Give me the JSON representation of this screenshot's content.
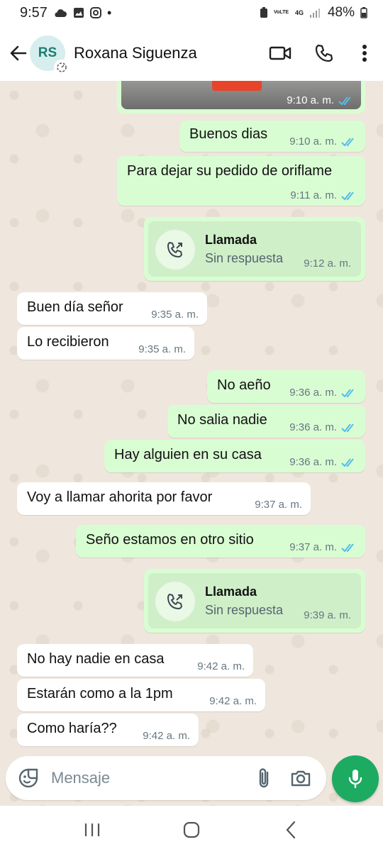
{
  "status_bar": {
    "time": "9:57",
    "dot": "•",
    "net_volte": "VoLTE",
    "net_4g": "4G",
    "battery": "48%"
  },
  "header": {
    "avatar_initials": "RS",
    "contact_name": "Roxana Siguenza"
  },
  "messages": [
    {
      "type": "image",
      "time": "9:10 a. m.",
      "dir": "out",
      "read": true
    },
    {
      "type": "text",
      "dir": "out",
      "text": "Buenos dias",
      "time": "9:10 a. m."
    },
    {
      "type": "text",
      "dir": "out",
      "text": "Para dejar su pedido de oriflame",
      "time": "9:11 a. m."
    },
    {
      "type": "call",
      "dir": "out",
      "title": "Llamada",
      "subtitle": "Sin respuesta",
      "time": "9:12 a. m."
    },
    {
      "type": "text",
      "dir": "in",
      "text": "Buen día señor",
      "time": "9:35 a. m."
    },
    {
      "type": "text",
      "dir": "in",
      "text": "Lo recibieron",
      "time": "9:35 a. m."
    },
    {
      "type": "text",
      "dir": "out",
      "text": "No aeño",
      "time": "9:36 a. m."
    },
    {
      "type": "text",
      "dir": "out",
      "text": "No salia nadie",
      "time": "9:36 a. m."
    },
    {
      "type": "text",
      "dir": "out",
      "text": "Hay alguien en su casa",
      "time": "9:36 a. m."
    },
    {
      "type": "text",
      "dir": "in",
      "text": "Voy a llamar ahorita por favor",
      "time": "9:37 a. m."
    },
    {
      "type": "text",
      "dir": "out",
      "text": "Seño estamos en otro sitio",
      "time": "9:37 a. m."
    },
    {
      "type": "call",
      "dir": "out",
      "title": "Llamada",
      "subtitle": "Sin respuesta",
      "time": "9:39 a. m."
    },
    {
      "type": "text",
      "dir": "in",
      "text": "No hay nadie en casa",
      "time": "9:42 a. m."
    },
    {
      "type": "text",
      "dir": "in",
      "text": "Estarán como a la 1pm",
      "time": "9:42 a. m."
    },
    {
      "type": "text",
      "dir": "in",
      "text": "Como haría??",
      "time": "9:42 a. m."
    }
  ],
  "input": {
    "placeholder": "Mensaje",
    "value": ""
  },
  "icons": {
    "back": "arrow-left-icon",
    "video": "video-camera-icon",
    "phone": "phone-icon",
    "menu": "more-vertical-icon",
    "emoji": "sticker-icon",
    "attach": "paperclip-icon",
    "camera": "camera-icon",
    "mic": "microphone-icon"
  },
  "colors": {
    "outgoing_bubble": "#d9fdd3",
    "incoming_bubble": "#ffffff",
    "read_ticks": "#53bdeb",
    "mic_button": "#1daa61",
    "avatar_bg": "#d6eeed",
    "avatar_text": "#1b7d74",
    "chat_bg": "#efe7dd"
  }
}
